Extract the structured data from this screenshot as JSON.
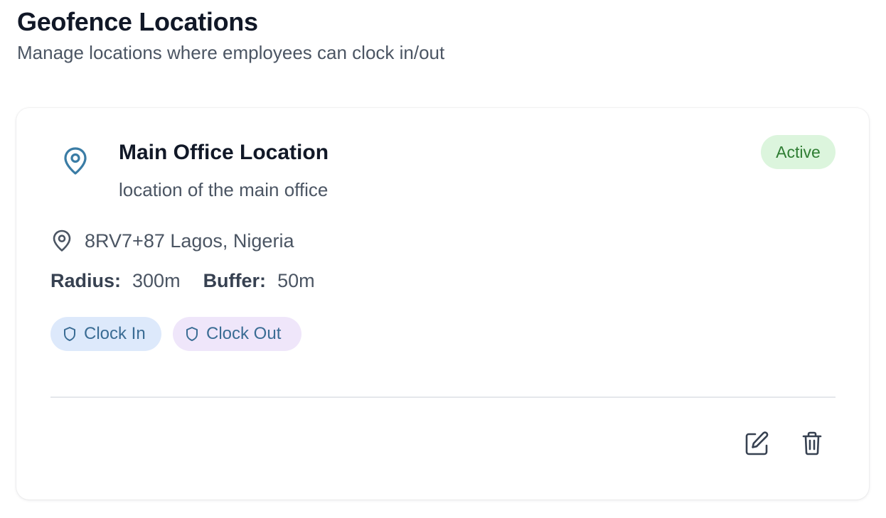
{
  "header": {
    "title": "Geofence Locations",
    "subtitle": "Manage locations where employees can clock in/out"
  },
  "location": {
    "name": "Main Office Location",
    "description": "location of the main office",
    "status": "Active",
    "address": "8RV7+87 Lagos, Nigeria",
    "radius_label": "Radius:",
    "radius_value": "300m",
    "buffer_label": "Buffer:",
    "buffer_value": "50m",
    "chips": {
      "clock_in": "Clock In",
      "clock_out": "Clock Out"
    }
  },
  "icons": {
    "main_pin": "map-pin-icon",
    "address_pin": "map-pin-icon",
    "chip": "shield-icon",
    "edit": "edit-icon",
    "delete": "trash-icon"
  },
  "colors": {
    "pin_blue": "#3a7ca5",
    "active_bg": "#dcf5dd",
    "active_text": "#2e7d32",
    "clock_in_bg": "#dde9fb",
    "clock_out_bg": "#efe6fa"
  }
}
